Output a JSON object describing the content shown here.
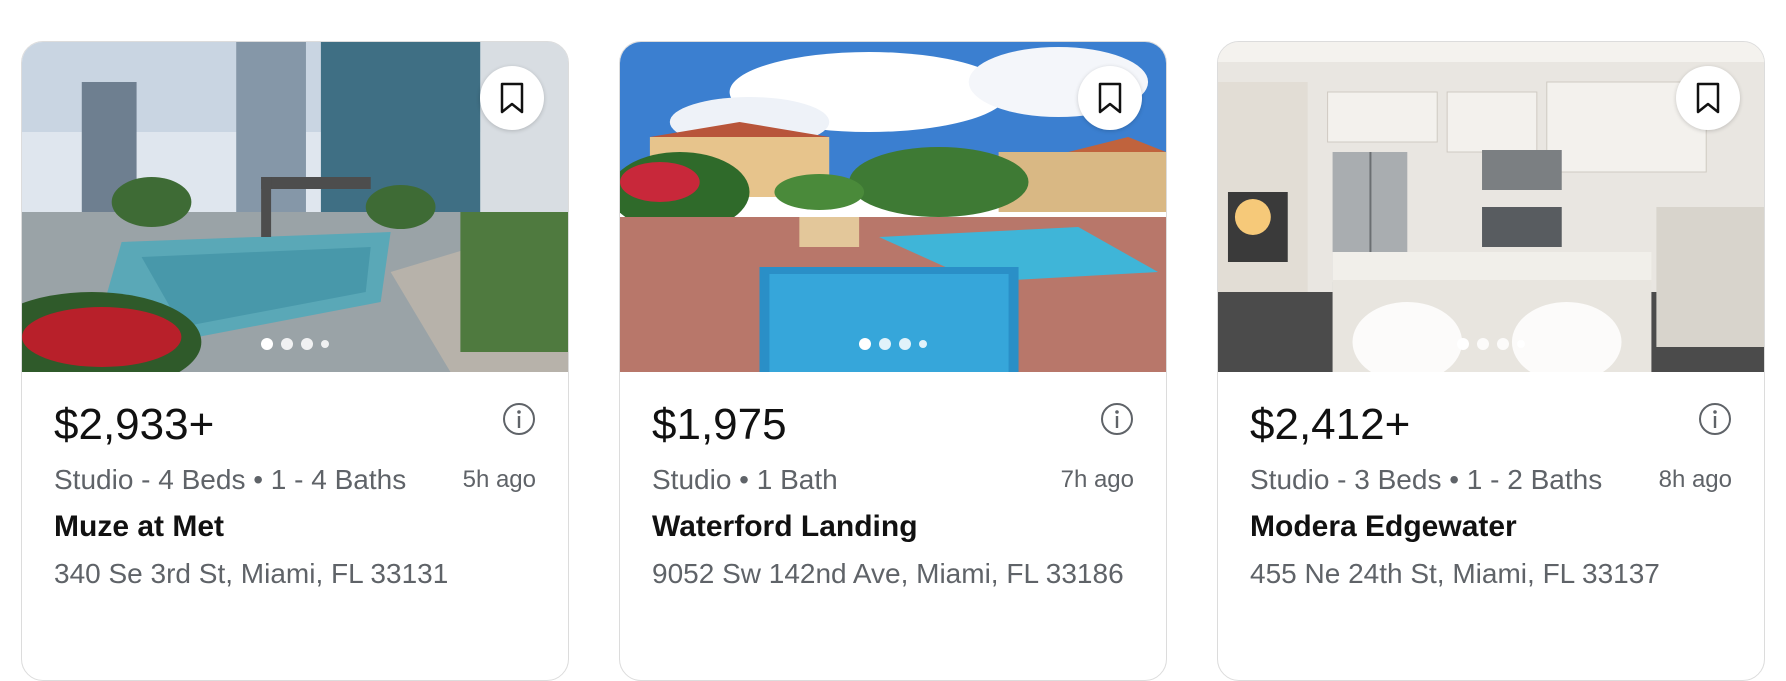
{
  "listings": [
    {
      "price": "$2,933+",
      "beds_baths": "Studio - 4 Beds • 1 - 4 Baths",
      "posted": "5h ago",
      "name": "Muze at Met",
      "address": "340 Se 3rd St, Miami, FL 33131",
      "photo_count_dots": 4,
      "active_photo": 1
    },
    {
      "price": "$1,975",
      "beds_baths": "Studio • 1 Bath",
      "posted": "7h ago",
      "name": "Waterford Landing",
      "address": "9052 Sw 142nd Ave, Miami, FL 33186",
      "photo_count_dots": 4,
      "active_photo": 1
    },
    {
      "price": "$2,412+",
      "beds_baths": "Studio - 3 Beds • 1 - 2 Baths",
      "posted": "8h ago",
      "name": "Modera Edgewater",
      "address": "455 Ne 24th St, Miami, FL 33137",
      "photo_count_dots": 4,
      "active_photo": 1
    }
  ],
  "icons": {
    "save": "bookmark-icon",
    "info": "info-icon"
  },
  "colors": {
    "text_primary": "#111111",
    "text_secondary": "#5f6368",
    "card_border": "#dcdcdc"
  }
}
